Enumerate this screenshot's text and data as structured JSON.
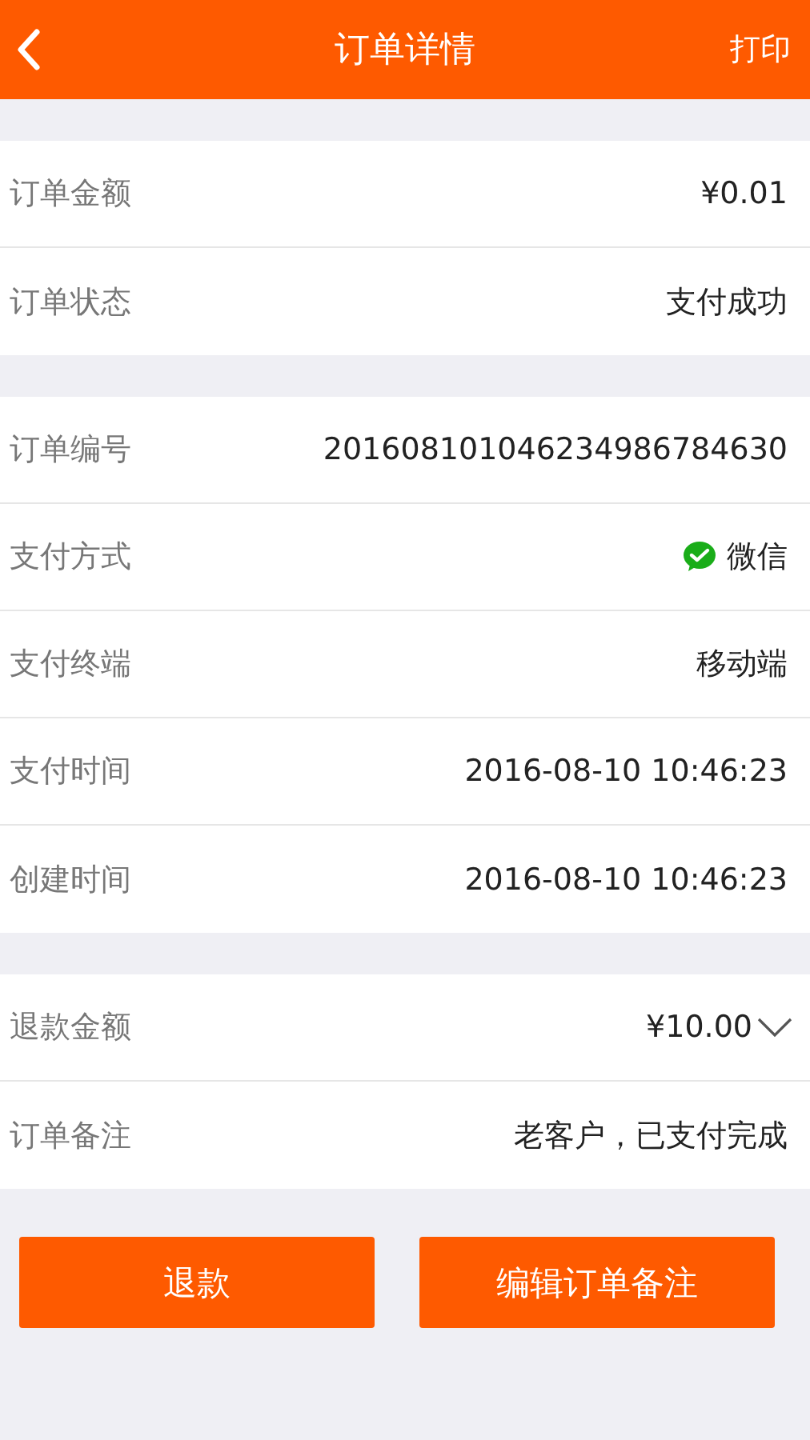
{
  "header": {
    "title": "订单详情",
    "action": "打印"
  },
  "groups": [
    {
      "rows": [
        {
          "label": "订单金额",
          "value": "¥0.01",
          "kind": "text"
        },
        {
          "label": "订单状态",
          "value": "支付成功",
          "kind": "text"
        }
      ]
    },
    {
      "rows": [
        {
          "label": "订单编号",
          "value": "201608101046234986784630",
          "kind": "text"
        },
        {
          "label": "支付方式",
          "value": "微信",
          "kind": "wechat"
        },
        {
          "label": "支付终端",
          "value": "移动端",
          "kind": "text"
        },
        {
          "label": "支付时间",
          "value": "2016-08-10 10:46:23",
          "kind": "text"
        },
        {
          "label": "创建时间",
          "value": "2016-08-10 10:46:23",
          "kind": "text"
        }
      ]
    },
    {
      "rows": [
        {
          "label": "退款金额",
          "value": "¥10.00",
          "kind": "dropdown"
        },
        {
          "label": "订单备注",
          "value": "老客户，已支付完成",
          "kind": "text"
        }
      ]
    }
  ],
  "buttons": [
    "退款",
    "编辑订单备注"
  ]
}
